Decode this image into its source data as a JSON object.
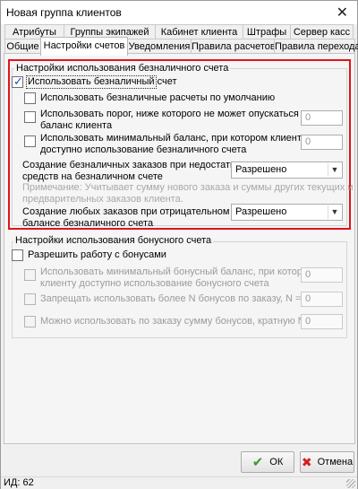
{
  "window": {
    "title": "Новая группа клиентов",
    "close_glyph": "✕"
  },
  "tabs_row1": [
    "Атрибуты",
    "Группы экипажей",
    "Кабинет клиента",
    "Штрафы",
    "Сервер касс"
  ],
  "tabs_row2": [
    "Общие",
    "Настройки счетов",
    "Уведомления",
    "Правила расчетов",
    "Правила перехода"
  ],
  "active_tab": "Настройки счетов",
  "cashless": {
    "group_title": "Настройки использования безналичного счета",
    "use_label": "Использовать безналичный счет",
    "use_checked": true,
    "default_label": "Использовать безналичные расчеты по умолчанию",
    "threshold_label_1": "Использовать порог, ниже которого не может опускаться",
    "threshold_label_2": "баланс клиента",
    "threshold_value": "0",
    "min_balance_label_1": "Использовать минимальный баланс, при котором клиенту",
    "min_balance_label_2": "доступно использование безналичного счета",
    "min_balance_value": "0",
    "insufficient_label_1": "Создание безналичных заказов при недостатке",
    "insufficient_label_2": "средств на безналичном счете",
    "insufficient_value": "Разрешено",
    "note_1": "Примечание: Учитывает сумму нового заказа и суммы других текущих и",
    "note_2": "предварительных заказов клиента.",
    "negative_label_1": "Создание любых заказов при отрицательном",
    "negative_label_2": "балансе безналичного счета",
    "negative_value": "Разрешено"
  },
  "bonus": {
    "group_title": "Настройки использования бонусного счета",
    "allow_label": "Разрешить работу с бонусами",
    "min_label_1": "Использовать минимальный бонусный баланс, при котором",
    "min_label_2": "клиенту доступно использование бонусного счета",
    "min_value": "0",
    "forbid_label": "Запрещать использовать более N бонусов по заказу, N =",
    "forbid_value": "0",
    "multiple_label": "Можно использовать по заказу сумму бонусов, кратную N, N =",
    "multiple_value": "0"
  },
  "buttons": {
    "ok": "ОК",
    "cancel": "Отмена"
  },
  "status": {
    "id_text": "ИД: 62"
  },
  "colors": {
    "highlight_border": "#e0141c",
    "ok_icon": "#3a9a2a",
    "cancel_icon": "#d52020"
  }
}
